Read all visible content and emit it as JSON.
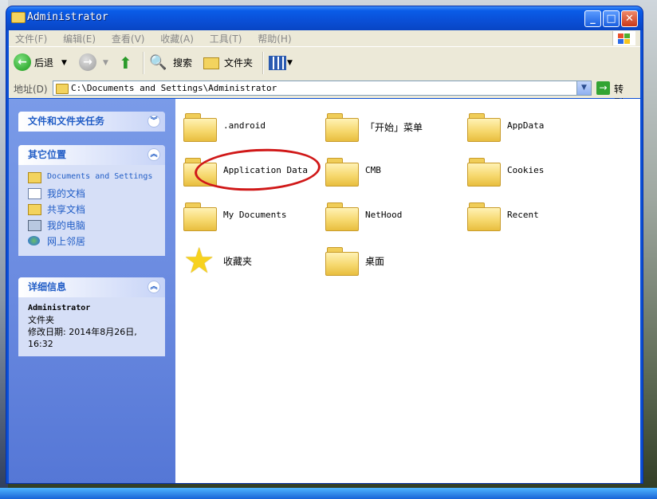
{
  "window": {
    "title": "Administrator",
    "controls": {
      "minimize": "_",
      "maximize": "□",
      "close": "✕"
    }
  },
  "menu": {
    "items": [
      "文件(F)",
      "编辑(E)",
      "查看(V)",
      "收藏(A)",
      "工具(T)",
      "帮助(H)"
    ]
  },
  "toolbar": {
    "back_label": "后退",
    "search_label": "搜索",
    "folders_label": "文件夹"
  },
  "address": {
    "label": "地址(D)",
    "path": "C:\\Documents and Settings\\Administrator",
    "go_label": "转到"
  },
  "left_pane": {
    "tasks_header": "文件和文件夹任务",
    "places_header": "其它位置",
    "places": [
      {
        "label": "Documents and Settings",
        "icon": "folder-icon"
      },
      {
        "label": "我的文档",
        "icon": "my-documents-icon"
      },
      {
        "label": "共享文档",
        "icon": "folder-icon"
      },
      {
        "label": "我的电脑",
        "icon": "my-computer-icon"
      },
      {
        "label": "网上邻居",
        "icon": "network-icon"
      }
    ],
    "details_header": "详细信息",
    "details": {
      "name": "Administrator",
      "type": "文件夹",
      "modified": "修改日期: 2014年8月26日, 16:32"
    }
  },
  "files": [
    {
      "name": ".android",
      "icon": "folder-icon"
    },
    {
      "name": "「开始」菜单",
      "icon": "folder-icon"
    },
    {
      "name": "AppData",
      "icon": "folder-icon"
    },
    {
      "name": "Application Data",
      "icon": "folder-icon"
    },
    {
      "name": "CMB",
      "icon": "folder-icon"
    },
    {
      "name": "Cookies",
      "icon": "folder-icon"
    },
    {
      "name": "My Documents",
      "icon": "folder-icon"
    },
    {
      "name": "NetHood",
      "icon": "folder-icon"
    },
    {
      "name": "Recent",
      "icon": "folder-icon"
    },
    {
      "name": "收藏夹",
      "icon": "favorites-star-icon"
    },
    {
      "name": "桌面",
      "icon": "folder-icon"
    }
  ],
  "colors": {
    "titlebar": "#0a4fd6",
    "left_pane": "#6a8ae0",
    "link": "#215dc6",
    "annotation": "#d01818"
  }
}
